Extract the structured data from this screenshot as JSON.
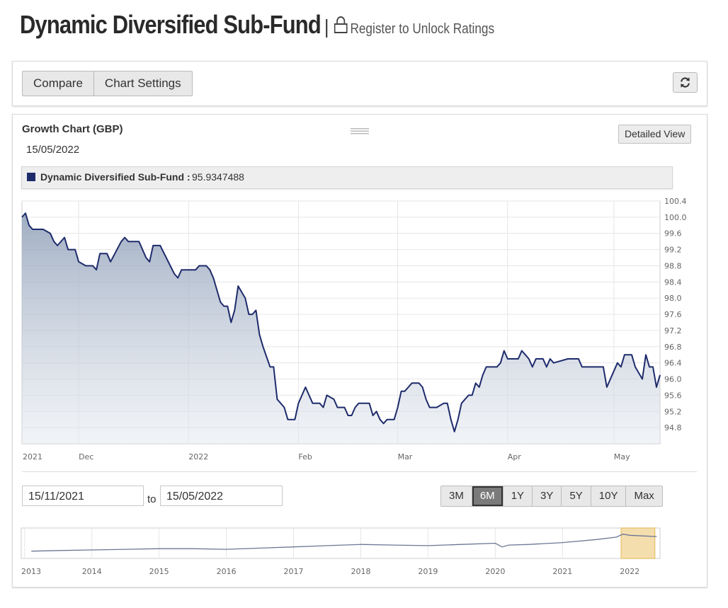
{
  "header": {
    "fund_title": "Dynamic Diversified Sub-Fund",
    "separator": "|",
    "register_link": "Register to Unlock Ratings"
  },
  "toolbar": {
    "compare_label": "Compare",
    "chart_settings_label": "Chart Settings",
    "refresh_icon": "refresh-icon"
  },
  "chart_panel": {
    "title": "Growth Chart (GBP)",
    "date": "15/05/2022",
    "detailed_view_label": "Detailed View",
    "legend": {
      "name": "Dynamic Diversified Sub-Fund",
      "separator": ":",
      "value": "95.9347488",
      "color": "#1e2b6b"
    }
  },
  "range": {
    "from_date": "15/11/2021",
    "to_label": "to",
    "to_date": "15/05/2022",
    "buttons": [
      "3M",
      "6M",
      "1Y",
      "3Y",
      "5Y",
      "10Y",
      "Max"
    ],
    "active": "6M"
  },
  "chart_data": [
    {
      "type": "area",
      "series": [
        {
          "name": "Dynamic Diversified Sub-Fund",
          "color": "#1e2b6b"
        }
      ],
      "x_tick_labels": [
        "2021",
        "Dec",
        "2022",
        "Feb",
        "Mar",
        "Apr",
        "May"
      ],
      "x_ticks_dates": [
        "2021-11-15",
        "2021-12-01",
        "2022-01-01",
        "2022-02-01",
        "2022-03-01",
        "2022-04-01",
        "2022-05-01"
      ],
      "y_tick_labels": [
        "94.8",
        "95.2",
        "95.6",
        "96.0",
        "96.4",
        "96.8",
        "97.2",
        "97.6",
        "98.0",
        "98.4",
        "98.8",
        "99.2",
        "99.6",
        "100.0",
        "100.4"
      ],
      "ylim": [
        94.4,
        100.4
      ],
      "grid": true,
      "x_dates": [
        "2021-11-15",
        "2021-11-16",
        "2021-11-17",
        "2021-11-18",
        "2021-11-21",
        "2021-11-23",
        "2021-11-24",
        "2021-11-25",
        "2021-11-27",
        "2021-11-28",
        "2021-11-30",
        "2021-12-01",
        "2021-12-03",
        "2021-12-05",
        "2021-12-06",
        "2021-12-07",
        "2021-12-09",
        "2021-12-10",
        "2021-12-13",
        "2021-12-14",
        "2021-12-15",
        "2021-12-17",
        "2021-12-18",
        "2021-12-20",
        "2021-12-21",
        "2021-12-22",
        "2021-12-24",
        "2021-12-28",
        "2021-12-29",
        "2021-12-30",
        "2022-01-03",
        "2022-01-04",
        "2022-01-05",
        "2022-01-06",
        "2022-01-07",
        "2022-01-08",
        "2022-01-10",
        "2022-01-11",
        "2022-01-12",
        "2022-01-13",
        "2022-01-14",
        "2022-01-15",
        "2022-01-17",
        "2022-01-18",
        "2022-01-19",
        "2022-01-20",
        "2022-01-21",
        "2022-01-22",
        "2022-01-24",
        "2022-01-25",
        "2022-01-26",
        "2022-01-27",
        "2022-01-28",
        "2022-01-29",
        "2022-01-31",
        "2022-02-01",
        "2022-02-02",
        "2022-02-03",
        "2022-02-05",
        "2022-02-06",
        "2022-02-07",
        "2022-02-08",
        "2022-02-09",
        "2022-02-11",
        "2022-02-12",
        "2022-02-14",
        "2022-02-15",
        "2022-02-16",
        "2022-02-17",
        "2022-02-18",
        "2022-02-19",
        "2022-02-21",
        "2022-02-22",
        "2022-02-23",
        "2022-02-24",
        "2022-02-25",
        "2022-02-26",
        "2022-02-28",
        "2022-03-01",
        "2022-03-02",
        "2022-03-03",
        "2022-03-04",
        "2022-03-05",
        "2022-03-07",
        "2022-03-08",
        "2022-03-09",
        "2022-03-10",
        "2022-03-11",
        "2022-03-12",
        "2022-03-14",
        "2022-03-15",
        "2022-03-16",
        "2022-03-17",
        "2022-03-18",
        "2022-03-19",
        "2022-03-21",
        "2022-03-22",
        "2022-03-23",
        "2022-03-24",
        "2022-03-25",
        "2022-03-26",
        "2022-03-28",
        "2022-03-29",
        "2022-03-30",
        "2022-03-31",
        "2022-04-01",
        "2022-04-02",
        "2022-04-04",
        "2022-04-05",
        "2022-04-06",
        "2022-04-07",
        "2022-04-08",
        "2022-04-09",
        "2022-04-11",
        "2022-04-12",
        "2022-04-13",
        "2022-04-14",
        "2022-04-18",
        "2022-04-19",
        "2022-04-20",
        "2022-04-21",
        "2022-04-22",
        "2022-04-25",
        "2022-04-26",
        "2022-04-27",
        "2022-04-28",
        "2022-04-29",
        "2022-05-02",
        "2022-05-03",
        "2022-05-04",
        "2022-05-05",
        "2022-05-06",
        "2022-05-07",
        "2022-05-09",
        "2022-05-10",
        "2022-05-11",
        "2022-05-12",
        "2022-05-13",
        "2022-05-14"
      ],
      "values": [
        100.0,
        100.1,
        99.8,
        99.7,
        99.7,
        99.6,
        99.4,
        99.3,
        99.5,
        99.2,
        99.2,
        98.9,
        98.8,
        98.8,
        98.7,
        99.1,
        99.1,
        98.9,
        99.4,
        99.5,
        99.4,
        99.4,
        99.4,
        99.0,
        98.9,
        99.3,
        99.3,
        98.6,
        98.5,
        98.7,
        98.7,
        98.8,
        98.8,
        98.8,
        98.7,
        98.5,
        97.9,
        97.8,
        97.8,
        97.4,
        97.7,
        98.3,
        98.0,
        97.6,
        97.6,
        97.7,
        97.1,
        96.8,
        96.3,
        96.3,
        95.5,
        95.4,
        95.3,
        95.0,
        95.0,
        95.4,
        95.6,
        95.8,
        95.4,
        95.4,
        95.4,
        95.3,
        95.6,
        95.5,
        95.3,
        95.3,
        95.1,
        95.1,
        95.3,
        95.4,
        95.4,
        95.4,
        95.1,
        95.2,
        95.0,
        94.9,
        95.0,
        95.0,
        95.3,
        95.7,
        95.7,
        95.8,
        95.9,
        95.9,
        95.8,
        95.5,
        95.3,
        95.3,
        95.3,
        95.4,
        95.4,
        95.0,
        94.7,
        95.0,
        95.4,
        95.6,
        95.6,
        95.9,
        95.8,
        96.1,
        96.3,
        96.3,
        96.3,
        96.4,
        96.7,
        96.5,
        96.5,
        96.5,
        96.7,
        96.6,
        96.5,
        96.3,
        96.5,
        96.5,
        96.3,
        96.5,
        96.4,
        96.5,
        96.5,
        96.5,
        96.5,
        96.3,
        96.3,
        96.3,
        96.3,
        96.3,
        95.8,
        96.4,
        96.3,
        96.6,
        96.6,
        96.6,
        96.3,
        96.0,
        96.6,
        96.3,
        96.3,
        95.8,
        96.1,
        95.9,
        95.9
      ]
    },
    {
      "type": "line",
      "series": [
        {
          "name": "Dynamic Diversified Sub-Fund"
        }
      ],
      "x_tick_labels": [
        "2013",
        "2014",
        "2015",
        "2016",
        "2017",
        "2018",
        "2019",
        "2020",
        "2021",
        "2022"
      ],
      "x_years": [
        2013.1,
        2013.5,
        2014,
        2014.5,
        2015,
        2015.5,
        2016,
        2016.5,
        2017,
        2017.5,
        2018,
        2018.5,
        2019,
        2019.5,
        2020,
        2020.1,
        2020.2,
        2020.5,
        2021,
        2021.5,
        2021.8,
        2021.9,
        2022.0,
        2022.2,
        2022.4
      ],
      "values": [
        72,
        73,
        74,
        75,
        76,
        76,
        75,
        77,
        79,
        81,
        83,
        82,
        81,
        83,
        85,
        79,
        82,
        83,
        86,
        91,
        95,
        100,
        98,
        97,
        96
      ],
      "selected_range": [
        "2021-11-15",
        "2022-05-15"
      ]
    }
  ]
}
